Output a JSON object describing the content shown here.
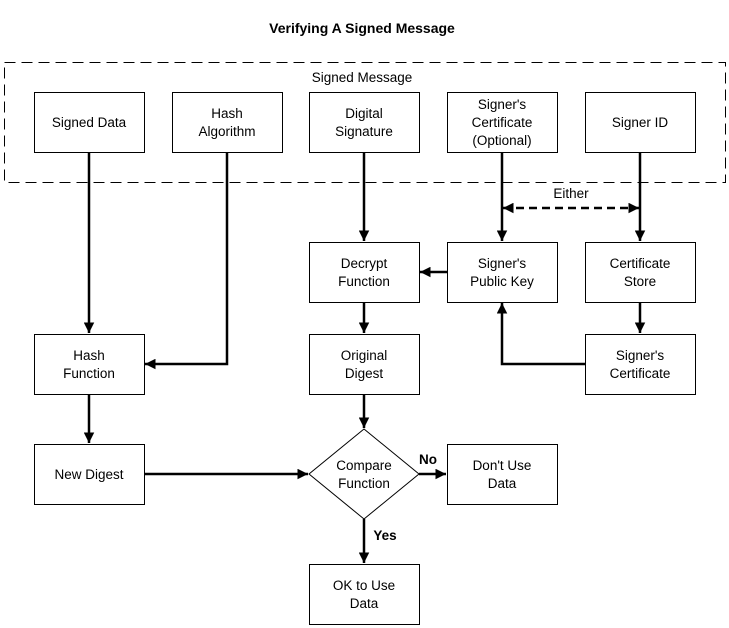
{
  "diagram": {
    "title": "Verifying A Signed Message",
    "group": {
      "label": "Signed Message"
    },
    "nodes": {
      "signed_data": {
        "lines": [
          "Signed Data"
        ]
      },
      "hash_algorithm": {
        "lines": [
          "Hash",
          "Algorithm"
        ]
      },
      "digital_signature": {
        "lines": [
          "Digital",
          "Signature"
        ]
      },
      "signers_certificate_optional": {
        "lines": [
          "Signer's",
          "Certificate",
          "(Optional)"
        ]
      },
      "signer_id": {
        "lines": [
          "Signer ID"
        ]
      },
      "decrypt_function": {
        "lines": [
          "Decrypt",
          "Function"
        ]
      },
      "signers_public_key": {
        "lines": [
          "Signer's",
          "Public Key"
        ]
      },
      "certificate_store": {
        "lines": [
          "Certificate",
          "Store"
        ]
      },
      "hash_function": {
        "lines": [
          "Hash",
          "Function"
        ]
      },
      "original_digest": {
        "lines": [
          "Original",
          "Digest"
        ]
      },
      "signers_certificate": {
        "lines": [
          "Signer's",
          "Certificate"
        ]
      },
      "new_digest": {
        "lines": [
          "New Digest"
        ]
      },
      "compare_function": {
        "lines": [
          "Compare",
          "Function"
        ]
      },
      "dont_use_data": {
        "lines": [
          "Don't Use",
          "Data"
        ]
      },
      "ok_to_use_data": {
        "lines": [
          "OK to Use",
          "Data"
        ]
      }
    },
    "edge_labels": {
      "either": "Either",
      "no": "No",
      "yes": "Yes"
    },
    "edges": [
      {
        "from": "signed_data",
        "to": "hash_function"
      },
      {
        "from": "hash_algorithm",
        "to": "hash_function"
      },
      {
        "from": "digital_signature",
        "to": "decrypt_function"
      },
      {
        "from": "signers_certificate_optional",
        "to": "signers_public_key"
      },
      {
        "from": "signer_id",
        "to": "certificate_store"
      },
      {
        "from": "signers_certificate_optional",
        "to": "signer_id",
        "style": "dashed",
        "bidirectional": true,
        "label": "either"
      },
      {
        "from": "signers_public_key",
        "to": "decrypt_function"
      },
      {
        "from": "certificate_store",
        "to": "signers_certificate"
      },
      {
        "from": "signers_certificate",
        "to": "signers_public_key"
      },
      {
        "from": "decrypt_function",
        "to": "original_digest"
      },
      {
        "from": "hash_function",
        "to": "new_digest"
      },
      {
        "from": "original_digest",
        "to": "compare_function"
      },
      {
        "from": "new_digest",
        "to": "compare_function"
      },
      {
        "from": "compare_function",
        "to": "dont_use_data",
        "label": "no"
      },
      {
        "from": "compare_function",
        "to": "ok_to_use_data",
        "label": "yes"
      }
    ]
  }
}
